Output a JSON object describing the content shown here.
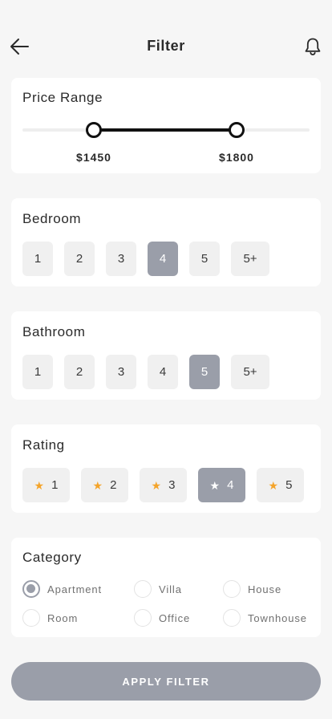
{
  "header": {
    "title": "Filter",
    "back_icon": "arrow-left-icon",
    "bell_icon": "bell-icon"
  },
  "price_range": {
    "title": "Price Range",
    "min_label": "$1450",
    "max_label": "$1800"
  },
  "bedroom": {
    "title": "Bedroom",
    "options": [
      "1",
      "2",
      "3",
      "4",
      "5",
      "5+"
    ],
    "selected": "4"
  },
  "bathroom": {
    "title": "Bathroom",
    "options": [
      "1",
      "2",
      "3",
      "4",
      "5",
      "5+"
    ],
    "selected": "5"
  },
  "rating": {
    "title": "Rating",
    "options": [
      "1",
      "2",
      "3",
      "4",
      "5"
    ],
    "selected": "4",
    "star_color": "#f4a42a"
  },
  "category": {
    "title": "Category",
    "options": [
      "Apartment",
      "Villa",
      "House",
      "Room",
      "Office",
      "Townhouse"
    ],
    "selected": "Apartment"
  },
  "apply_button": {
    "label": "APPLY FILTER"
  },
  "colors": {
    "accent": "#9a9ea9",
    "background": "#f6f6f6",
    "card": "#ffffff",
    "slider": "#111111"
  }
}
